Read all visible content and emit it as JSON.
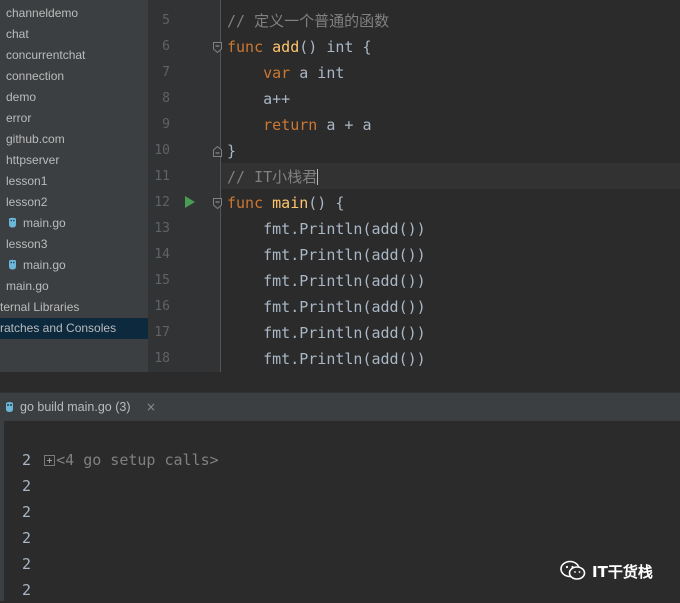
{
  "project_tree": {
    "items": [
      {
        "label": "channeldemo",
        "kind": "folder"
      },
      {
        "label": "chat",
        "kind": "folder"
      },
      {
        "label": "concurrentchat",
        "kind": "folder"
      },
      {
        "label": "connection",
        "kind": "folder"
      },
      {
        "label": "demo",
        "kind": "folder"
      },
      {
        "label": "error",
        "kind": "folder"
      },
      {
        "label": "github.com",
        "kind": "folder"
      },
      {
        "label": "httpserver",
        "kind": "folder"
      },
      {
        "label": "lesson1",
        "kind": "folder"
      },
      {
        "label": "lesson2",
        "kind": "folder"
      },
      {
        "label": "main.go",
        "kind": "go-file"
      },
      {
        "label": "lesson3",
        "kind": "folder"
      },
      {
        "label": "main.go",
        "kind": "go-file"
      },
      {
        "label": "main.go",
        "kind": "file"
      },
      {
        "label": "ternal Libraries",
        "kind": "libs"
      },
      {
        "label": "ratches and Consoles",
        "kind": "scratches",
        "selected": true
      }
    ]
  },
  "editor": {
    "line_numbers": [
      "5",
      "6",
      "7",
      "8",
      "9",
      "10",
      "11",
      "12",
      "13",
      "14",
      "15",
      "16",
      "17",
      "18"
    ],
    "lines": [
      {
        "parts": [
          {
            "t": "// 定义一个普通的函数",
            "c": "cm"
          }
        ]
      },
      {
        "parts": [
          {
            "t": "func",
            "c": "kw"
          },
          {
            "t": " ",
            "c": ""
          },
          {
            "t": "add",
            "c": "fn"
          },
          {
            "t": "() ",
            "c": ""
          },
          {
            "t": "int",
            "c": ""
          },
          {
            "t": " {",
            "c": ""
          }
        ]
      },
      {
        "parts": [
          {
            "t": "    ",
            "c": ""
          },
          {
            "t": "var",
            "c": "kw"
          },
          {
            "t": " a int",
            "c": ""
          }
        ]
      },
      {
        "parts": [
          {
            "t": "    a++",
            "c": ""
          }
        ]
      },
      {
        "parts": [
          {
            "t": "    ",
            "c": ""
          },
          {
            "t": "return",
            "c": "kw"
          },
          {
            "t": " a + a",
            "c": ""
          }
        ]
      },
      {
        "parts": [
          {
            "t": "}",
            "c": ""
          }
        ]
      },
      {
        "parts": [
          {
            "t": "// IT小栈君",
            "c": "cm"
          }
        ]
      },
      {
        "parts": [
          {
            "t": "func",
            "c": "kw"
          },
          {
            "t": " ",
            "c": ""
          },
          {
            "t": "main",
            "c": "fn"
          },
          {
            "t": "() {",
            "c": ""
          }
        ]
      },
      {
        "parts": [
          {
            "t": "    fmt.Println(add())",
            "c": ""
          }
        ]
      },
      {
        "parts": [
          {
            "t": "    fmt.Println(add())",
            "c": ""
          }
        ]
      },
      {
        "parts": [
          {
            "t": "    fmt.Println(add())",
            "c": ""
          }
        ]
      },
      {
        "parts": [
          {
            "t": "    fmt.Println(add())",
            "c": ""
          }
        ]
      },
      {
        "parts": [
          {
            "t": "    fmt.Println(add())",
            "c": ""
          }
        ]
      },
      {
        "parts": [
          {
            "t": "    fmt.Println(add())",
            "c": ""
          }
        ]
      }
    ]
  },
  "run_panel": {
    "tab_label": "go build main.go (3)",
    "tab_close": "×",
    "setup_calls": "<4 go setup calls>",
    "output": [
      "2",
      "2",
      "2",
      "2",
      "2",
      "2"
    ]
  },
  "watermark": {
    "text": "IT干货栈"
  },
  "colors": {
    "keyword": "#cc7832",
    "function": "#ffc66d",
    "comment": "#808080",
    "run_green": "#499c54"
  }
}
